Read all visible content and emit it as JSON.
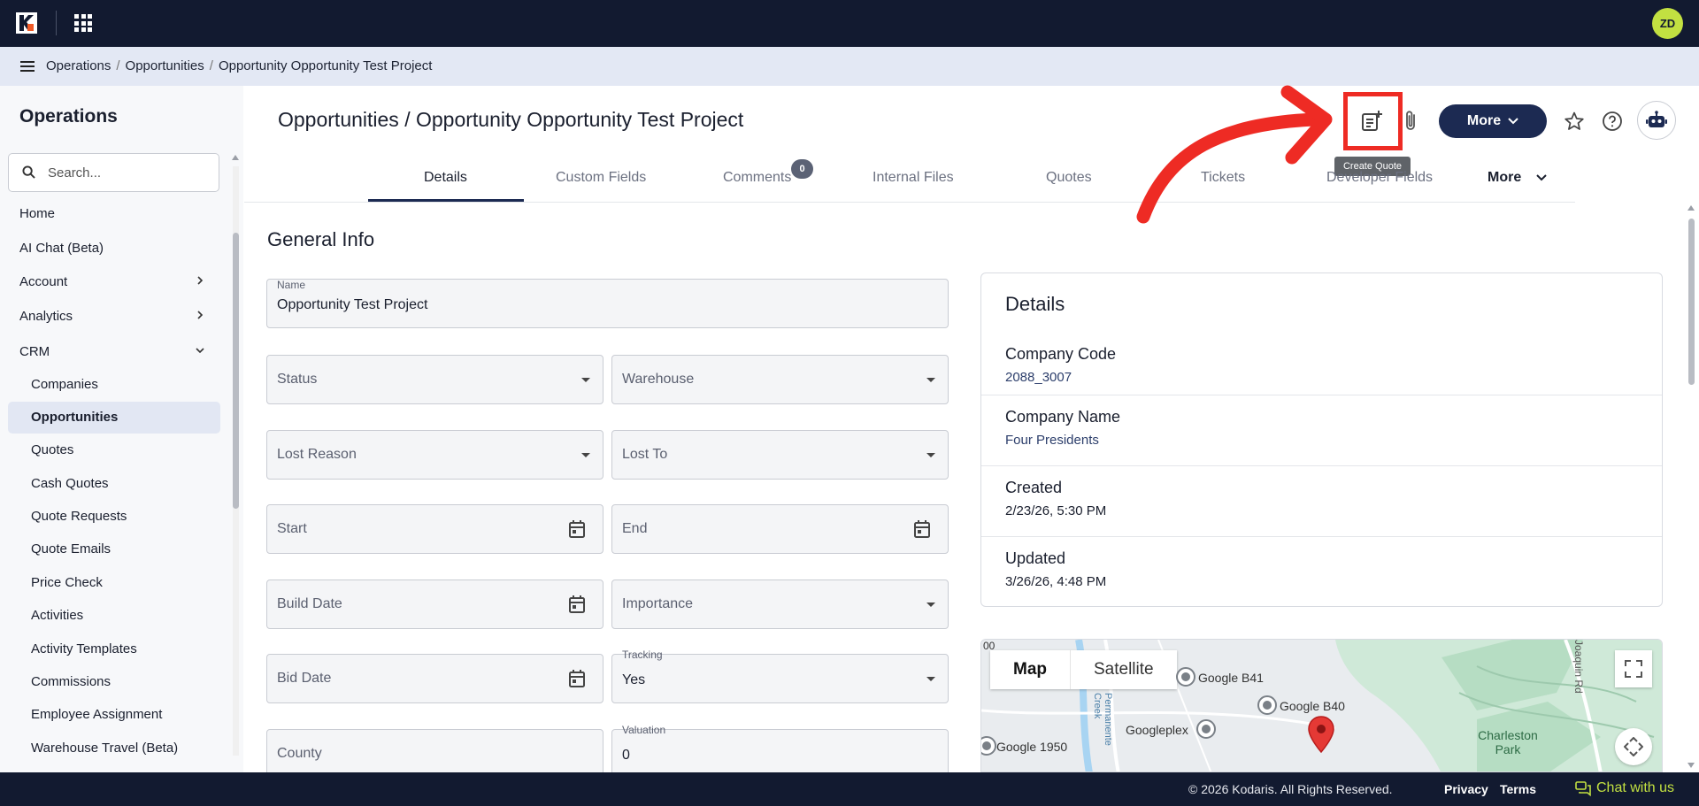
{
  "topbar": {
    "avatar_initials": "ZD"
  },
  "breadcrumb": [
    "Operations",
    "Opportunities",
    "Opportunity Opportunity Test Project"
  ],
  "sidebar": {
    "title": "Operations",
    "search_placeholder": "Search...",
    "items": [
      {
        "label": "Home"
      },
      {
        "label": "AI Chat (Beta)"
      },
      {
        "label": "Account",
        "expandable": true
      },
      {
        "label": "Analytics",
        "expandable": true
      },
      {
        "label": "CRM",
        "expanded": true
      }
    ],
    "crm_children": [
      "Companies",
      "Opportunities",
      "Quotes",
      "Cash Quotes",
      "Quote Requests",
      "Quote Emails",
      "Price Check",
      "Activities",
      "Activity Templates",
      "Commissions",
      "Employee Assignment",
      "Warehouse Travel (Beta)"
    ],
    "active_item": "Opportunities"
  },
  "header": {
    "title": "Opportunities / Opportunity Opportunity Test Project",
    "more_label": "More",
    "tooltip": "Create Quote"
  },
  "tabs": {
    "items": [
      "Details",
      "Custom Fields",
      "Comments",
      "Internal Files",
      "Quotes",
      "Tickets",
      "Developer Fields"
    ],
    "active": "Details",
    "comments_badge": "0",
    "more_label": "More"
  },
  "form": {
    "section_title": "General Info",
    "name_label": "Name",
    "name_value": "Opportunity Test Project",
    "status_label": "Status",
    "warehouse_label": "Warehouse",
    "lost_reason_label": "Lost Reason",
    "lost_to_label": "Lost To",
    "start_label": "Start",
    "end_label": "End",
    "build_date_label": "Build Date",
    "importance_label": "Importance",
    "bid_date_label": "Bid Date",
    "tracking_label": "Tracking",
    "tracking_value": "Yes",
    "county_label": "County",
    "valuation_label": "Valuation",
    "valuation_value": "0"
  },
  "details": {
    "title": "Details",
    "company_code_label": "Company Code",
    "company_code_value": "2088_3007",
    "company_name_label": "Company Name",
    "company_name_value": "Four Presidents",
    "created_label": "Created",
    "created_value": "2/23/26, 5:30 PM",
    "updated_label": "Updated",
    "updated_value": "3/26/26, 4:48 PM"
  },
  "map": {
    "map_label": "Map",
    "satellite_label": "Satellite",
    "places": [
      "Google B41",
      "Google B40",
      "Googleplex",
      "Google 1950",
      "Charleston Park",
      "Joaquin Rd",
      "Permanente Creek",
      "00"
    ]
  },
  "footer": {
    "copyright": "© 2026 Kodaris. All Rights Reserved.",
    "privacy": "Privacy",
    "terms": "Terms",
    "chat": "Chat with us"
  },
  "colors": {
    "topbar": "#121a30",
    "accent": "#1c2a52",
    "highlight": "#ee2b24",
    "avatar": "#c2e041"
  }
}
